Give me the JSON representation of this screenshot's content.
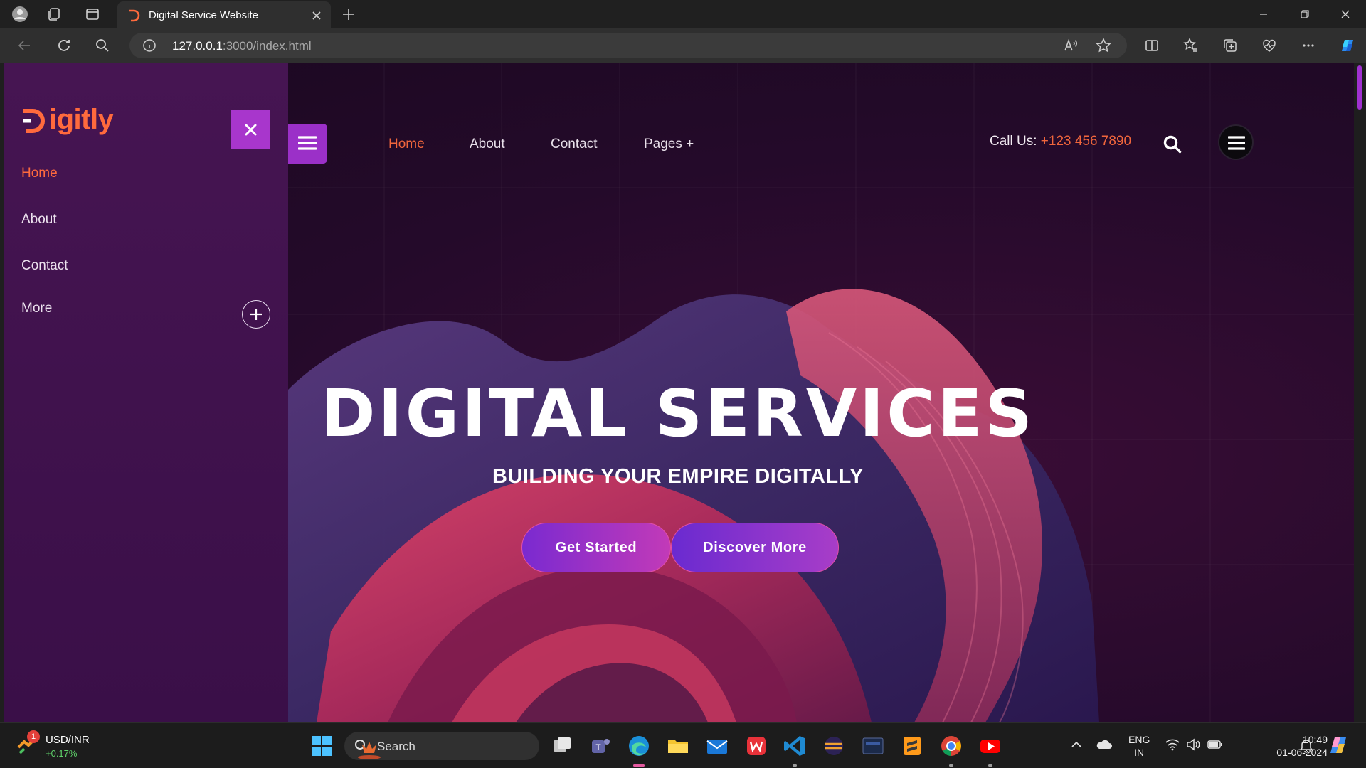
{
  "browser": {
    "tab_title": "Digital Service Website",
    "url_host": "127.0.0.1",
    "url_rest": ":3000/index.html"
  },
  "sidebar": {
    "logo": "igitly",
    "items": [
      {
        "label": "Home"
      },
      {
        "label": "About"
      },
      {
        "label": "Contact"
      },
      {
        "label": "More"
      }
    ]
  },
  "header": {
    "nav": [
      {
        "label": "Home"
      },
      {
        "label": "About"
      },
      {
        "label": "Contact"
      },
      {
        "label": "Pages +"
      }
    ],
    "call_label": "Call Us: ",
    "call_number": "+123 456 7890"
  },
  "hero": {
    "title": "DIGITAL SERVICES",
    "subtitle": "BUILDING YOUR EMPIRE DIGITALLY",
    "primary_button": "Get Started",
    "secondary_button": "Discover More"
  },
  "taskbar": {
    "widget_label": "USD/INR",
    "widget_change": "+0.17%",
    "widget_badge": "1",
    "search_placeholder": "Search",
    "lang_line1": "ENG",
    "lang_line2": "IN",
    "time": "10:49",
    "date": "01-06-2024"
  },
  "colors": {
    "accent_orange": "#ff6a3d",
    "accent_purple": "#9b30c8",
    "sidebar_bg": "#461552"
  }
}
